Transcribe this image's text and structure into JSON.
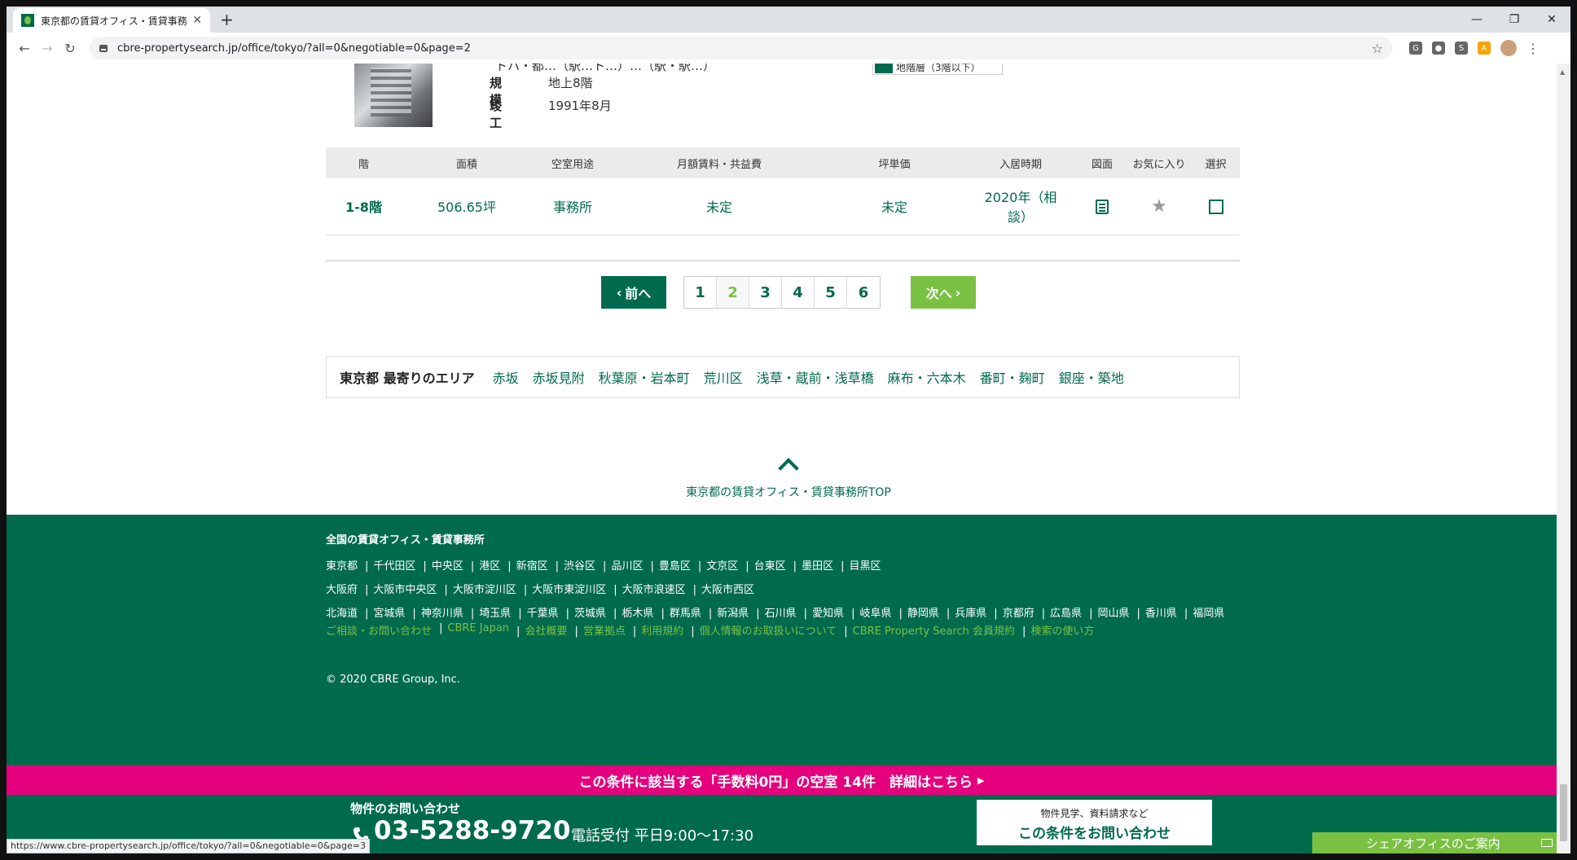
{
  "browser": {
    "tab_title": "東京都の賃貸オフィス・賃貸事務所",
    "tab_close": "✕",
    "new_tab": "+",
    "url": "cbre-propertysearch.jp/office/tokyo/?all=0&negotiable=0&page=2",
    "status_url": "https://www.cbre-propertysearch.jp/office/tokyo/?all=0&negotiable=0&page=3",
    "window_controls": [
      "—",
      "❐",
      "✕"
    ],
    "extensions": [
      "G",
      "●",
      "S",
      "A"
    ]
  },
  "building": {
    "partial_row": "トハ・都…（駅…ト…）…（駅・駅…）",
    "partial_badge": "地階層（3階以下）",
    "specs": [
      {
        "label": "規模",
        "value": "地上8階"
      },
      {
        "label": "竣工",
        "value": "1991年8月"
      }
    ]
  },
  "table": {
    "headers": [
      "階",
      "面積",
      "空室用途",
      "月額賃料・共益費",
      "坪単価",
      "入居時期",
      "図面",
      "お気に入り",
      "選択"
    ],
    "rows": [
      {
        "floor": "1-8階",
        "area": "506.65坪",
        "use": "事務所",
        "rent": "未定",
        "unit_price": "未定",
        "move_in_line1": "2020年（相",
        "move_in_line2": "談）"
      }
    ]
  },
  "pagination": {
    "prev": "前へ",
    "next": "次へ",
    "pages": [
      "1",
      "2",
      "3",
      "4",
      "5",
      "6"
    ],
    "current": "2"
  },
  "nearby": {
    "label": "東京都 最寄りのエリア",
    "areas": [
      "赤坂",
      "赤坂見附",
      "秋葉原・岩本町",
      "荒川区",
      "浅草・蔵前・浅草橋",
      "麻布・六本木",
      "番町・麹町",
      "銀座・築地"
    ]
  },
  "back_to_top": "東京都の賃貸オフィス・賃貸事務所TOP",
  "footer": {
    "title": "全国の賃貸オフィス・賃貸事務所",
    "row1": [
      "東京都",
      "千代田区",
      "中央区",
      "港区",
      "新宿区",
      "渋谷区",
      "品川区",
      "豊島区",
      "文京区",
      "台東区",
      "墨田区",
      "目黒区"
    ],
    "row2": [
      "大阪府",
      "大阪市中央区",
      "大阪市淀川区",
      "大阪市東淀川区",
      "大阪市浪速区",
      "大阪市西区"
    ],
    "row3": [
      "北海道",
      "宮城県",
      "神奈川県",
      "埼玉県",
      "千葉県",
      "茨城県",
      "栃木県",
      "群馬県",
      "新潟県",
      "石川県",
      "愛知県",
      "岐阜県",
      "静岡県",
      "兵庫県",
      "京都府",
      "広島県",
      "岡山県",
      "香川県",
      "福岡県"
    ],
    "links": [
      "ご相談・お問い合わせ",
      "CBRE Japan",
      "会社概要",
      "営業拠点",
      "利用規約",
      "個人情報のお取扱いについて",
      "CBRE Property Search 会員規約",
      "検索の使い方"
    ],
    "copyright": "© 2020 CBRE Group, Inc."
  },
  "banner": {
    "text": "この条件に該当する「手数料0円」の空室 14件　詳細はこちら",
    "arrow": "▶"
  },
  "contact": {
    "title": "物件のお問い合わせ",
    "phone": "03-5288-9720",
    "hours": "電話受付 平日9:00～17:30",
    "cta_small": "物件見学、資料請求など",
    "cta_big": "この条件をお問い合わせ"
  },
  "share_office": "シェアオフィスのご案内",
  "colors": {
    "brand_green": "#006a4d",
    "accent_green": "#7ac143",
    "pink": "#e5007e"
  }
}
